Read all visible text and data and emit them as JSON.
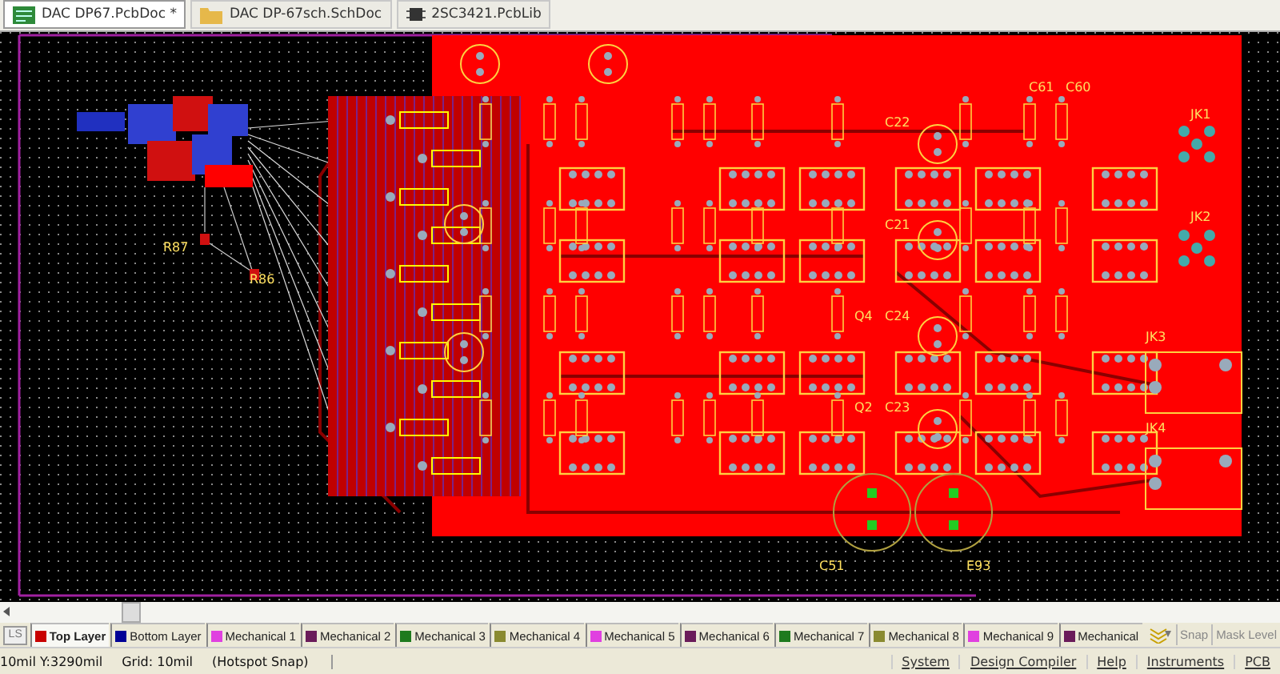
{
  "document_tabs": [
    {
      "label": "DAC DP67.PcbDoc *",
      "kind": "pcb",
      "selected": true
    },
    {
      "label": "DAC DP-67sch.SchDoc",
      "kind": "sch",
      "selected": false
    },
    {
      "label": "2SC3421.PcbLib",
      "kind": "lib",
      "selected": false
    }
  ],
  "canvas": {
    "designators": [
      "C61",
      "C60",
      "JK1",
      "C22",
      "JK2",
      "C21",
      "R87",
      "R86",
      "Q4",
      "C24",
      "JK3",
      "Q2",
      "C23",
      "JK4",
      "C51",
      "E93"
    ]
  },
  "layer_bar": {
    "ls_button": "LS",
    "layers": [
      {
        "label": "Top Layer",
        "color": "#c80000",
        "selected": true
      },
      {
        "label": "Bottom Layer",
        "color": "#000096",
        "selected": false
      },
      {
        "label": "Mechanical 1",
        "color": "#e040e0",
        "selected": false
      },
      {
        "label": "Mechanical 2",
        "color": "#6a1b5a",
        "selected": false
      },
      {
        "label": "Mechanical 3",
        "color": "#1e7a1e",
        "selected": false
      },
      {
        "label": "Mechanical 4",
        "color": "#8a8a30",
        "selected": false
      },
      {
        "label": "Mechanical 5",
        "color": "#e040e0",
        "selected": false
      },
      {
        "label": "Mechanical 6",
        "color": "#6a1b5a",
        "selected": false
      },
      {
        "label": "Mechanical 7",
        "color": "#1e7a1e",
        "selected": false
      },
      {
        "label": "Mechanical 8",
        "color": "#8a8a30",
        "selected": false
      },
      {
        "label": "Mechanical 9",
        "color": "#e040e0",
        "selected": false
      },
      {
        "label": "Mechanical",
        "color": "#6a1b5a",
        "selected": false
      }
    ],
    "buttons": [
      "Snap",
      "Mask Level"
    ]
  },
  "status_bar": {
    "coordinates": "10mil Y:3290mil",
    "grid": "Grid: 10mil",
    "snap": "(Hotspot Snap)",
    "panels": [
      "System",
      "Design Compiler",
      "Help",
      "Instruments",
      "PCB"
    ]
  }
}
